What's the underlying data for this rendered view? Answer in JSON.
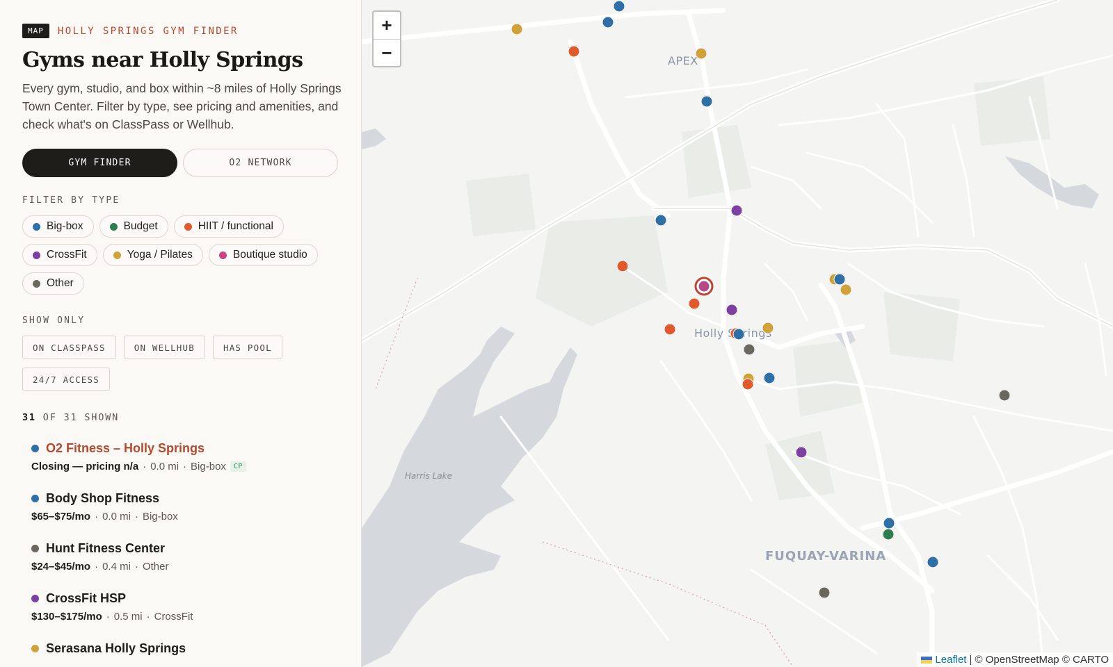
{
  "header": {
    "badge": "MAP",
    "eyebrow": "HOLLY SPRINGS GYM FINDER",
    "title": "Gyms near Holly Springs",
    "subtitle": "Every gym, studio, and box within ~8 miles of Holly Springs Town Center. Filter by type, see pricing and amenities, and check what's on ClassPass or Wellhub."
  },
  "tabs": [
    {
      "label": "GYM FINDER",
      "active": true
    },
    {
      "label": "O2 NETWORK",
      "active": false
    }
  ],
  "filter": {
    "label": "FILTER BY TYPE",
    "types": [
      {
        "label": "Big-box",
        "color": "#2e6fa5"
      },
      {
        "label": "Budget",
        "color": "#2f7d4f"
      },
      {
        "label": "HIIT / functional",
        "color": "#e05a2b"
      },
      {
        "label": "CrossFit",
        "color": "#7d3fa0"
      },
      {
        "label": "Yoga / Pilates",
        "color": "#cfa23a"
      },
      {
        "label": "Boutique studio",
        "color": "#c94580"
      },
      {
        "label": "Other",
        "color": "#6b665e"
      }
    ]
  },
  "show_only": {
    "label": "SHOW ONLY",
    "options": [
      "ON CLASSPASS",
      "ON WELLHUB",
      "HAS POOL",
      "24/7 ACCESS"
    ]
  },
  "count": {
    "shown": "31",
    "rest": "OF 31 SHOWN"
  },
  "gyms": [
    {
      "name": "O2 Fitness – Holly Springs",
      "price": "Closing — pricing n/a",
      "distance": "0.0 mi",
      "type": "Big-box",
      "color": "#2e6fa5",
      "badge": "CP",
      "selected": true
    },
    {
      "name": "Body Shop Fitness",
      "price": "$65–$75/mo",
      "distance": "0.0 mi",
      "type": "Big-box",
      "color": "#2e6fa5",
      "badge": "",
      "selected": false
    },
    {
      "name": "Hunt Fitness Center",
      "price": "$24–$45/mo",
      "distance": "0.4 mi",
      "type": "Other",
      "color": "#6b665e",
      "badge": "",
      "selected": false
    },
    {
      "name": "CrossFit HSP",
      "price": "$130–$175/mo",
      "distance": "0.5 mi",
      "type": "CrossFit",
      "color": "#7d3fa0",
      "badge": "",
      "selected": false
    },
    {
      "name": "Serasana Holly Springs",
      "price": "",
      "distance": "",
      "type": "",
      "color": "#cfa23a",
      "badge": "",
      "selected": false
    }
  ],
  "map": {
    "zoom_in": "+",
    "zoom_out": "−",
    "places": {
      "apex": "APEX",
      "holly_springs": "Holly Springs",
      "fuquay": "FUQUAY-VARINA",
      "harris_lake": "Harris Lake"
    },
    "attribution": {
      "leaflet": "Leaflet",
      "rest": "| © OpenStreetMap © CARTO"
    }
  }
}
